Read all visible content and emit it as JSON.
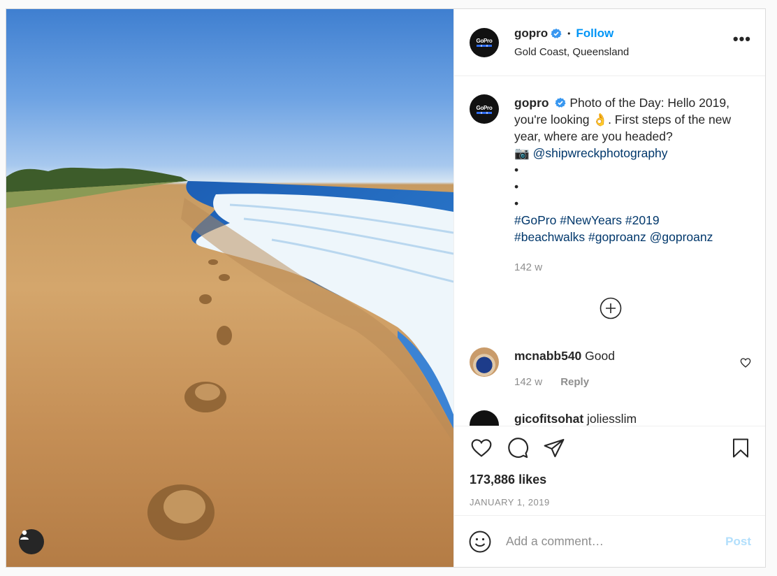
{
  "post": {
    "username": "gopro",
    "avatar_text": "GoPro",
    "follow_label": "Follow",
    "separator": "•",
    "location": "Gold Coast, Queensland",
    "more_label": "•••"
  },
  "caption": {
    "username": "gopro",
    "text": "Photo of the Day: Hello 2019, you're looking 👌. First steps of the new year, where are you headed?",
    "camera": "📷",
    "mention": "@shipwreckphotography",
    "dots": [
      "•",
      "•",
      "•"
    ],
    "hashtags_line1": [
      "#GoPro",
      "#NewYears",
      "#2019"
    ],
    "hashtags_line2": [
      "#beachwalks",
      "#goproanz"
    ],
    "mention2": "@goproanz",
    "time": "142 w"
  },
  "comments": [
    {
      "username": "mcnabb540",
      "text": "Good",
      "time": "142 w",
      "reply_label": "Reply"
    },
    {
      "username": "gicofitsohat",
      "text": "joliesslim"
    }
  ],
  "actions": {
    "likes": "173,886 likes",
    "date": "JANUARY 1, 2019"
  },
  "add_comment": {
    "placeholder": "Add a comment…",
    "post_label": "Post"
  },
  "colors": {
    "link": "#00376b",
    "follow": "#0095f6",
    "post_disabled": "#b2dffc",
    "verified": "#3897f0"
  },
  "icons": {
    "verified": "verified-badge-icon",
    "like": "heart-icon",
    "comment": "comment-bubble-icon",
    "share": "paper-plane-icon",
    "save": "bookmark-icon",
    "emoji": "smiley-icon",
    "load_more": "plus-circle-icon",
    "user_tag": "person-icon"
  }
}
